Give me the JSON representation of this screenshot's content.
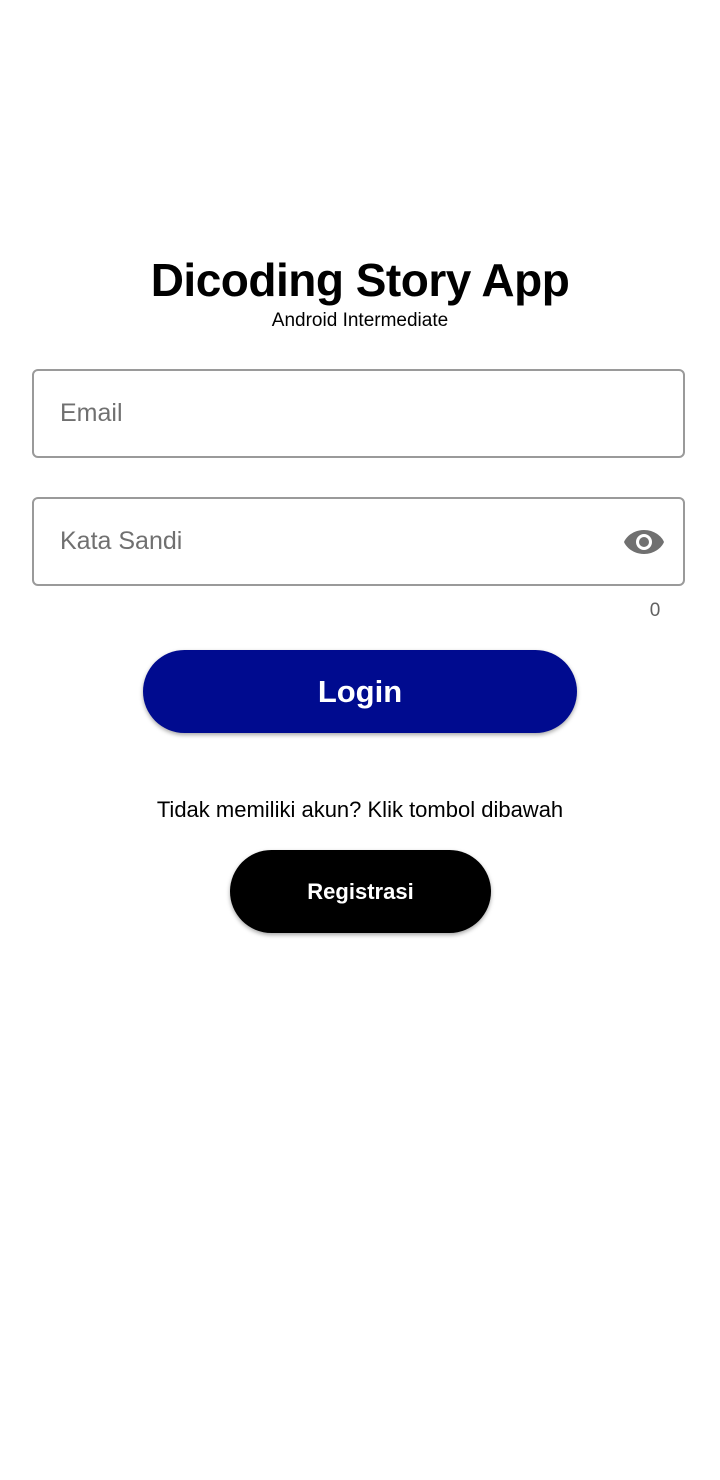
{
  "header": {
    "title": "Dicoding Story App",
    "subtitle": "Android Intermediate"
  },
  "form": {
    "email": {
      "value": "",
      "placeholder": "Email"
    },
    "password": {
      "value": "",
      "placeholder": "Kata Sandi",
      "toggle_icon": "eye-icon",
      "char_counter": "0"
    },
    "login_label": "Login"
  },
  "register": {
    "prompt": "Tidak memiliki akun? Klik tombol dibawah",
    "button_label": "Registrasi"
  },
  "colors": {
    "login_button": "#000b8f",
    "register_button": "#000000",
    "field_border": "#9a9a9a",
    "icon": "#707070"
  }
}
